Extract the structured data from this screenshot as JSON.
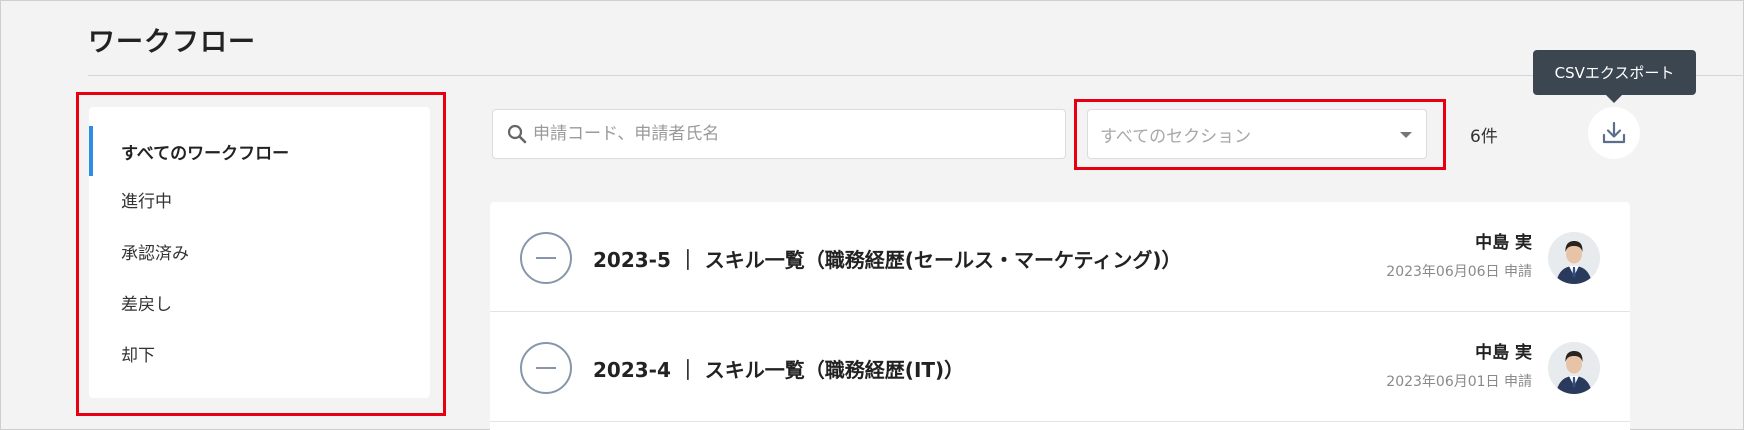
{
  "page": {
    "title": "ワークフロー"
  },
  "sidebar": {
    "items": [
      {
        "label": "すべてのワークフロー",
        "active": true
      },
      {
        "label": "進行中",
        "active": false
      },
      {
        "label": "承認済み",
        "active": false
      },
      {
        "label": "差戻し",
        "active": false
      },
      {
        "label": "却下",
        "active": false
      }
    ]
  },
  "toolbar": {
    "search": {
      "placeholder": "申請コード、申請者氏名",
      "value": ""
    },
    "section_select": {
      "value": "すべてのセクション"
    },
    "count": "6件",
    "export_tooltip": "CSVエクスポート"
  },
  "workflows": [
    {
      "title": "2023-5 ｜ スキル一覧（職務経歴(セールス・マーケティング)）",
      "applicant": "中島 実",
      "date": "2023年06月06日 申請",
      "status_icon": "minus-circle-icon"
    },
    {
      "title": "2023-4 ｜ スキル一覧（職務経歴(IT)）",
      "applicant": "中島 実",
      "date": "2023年06月01日 申請",
      "status_icon": "minus-circle-icon"
    }
  ],
  "colors": {
    "accent": "#2e8ce6",
    "highlight": "#e60012",
    "tooltip_bg": "#3b4650"
  }
}
